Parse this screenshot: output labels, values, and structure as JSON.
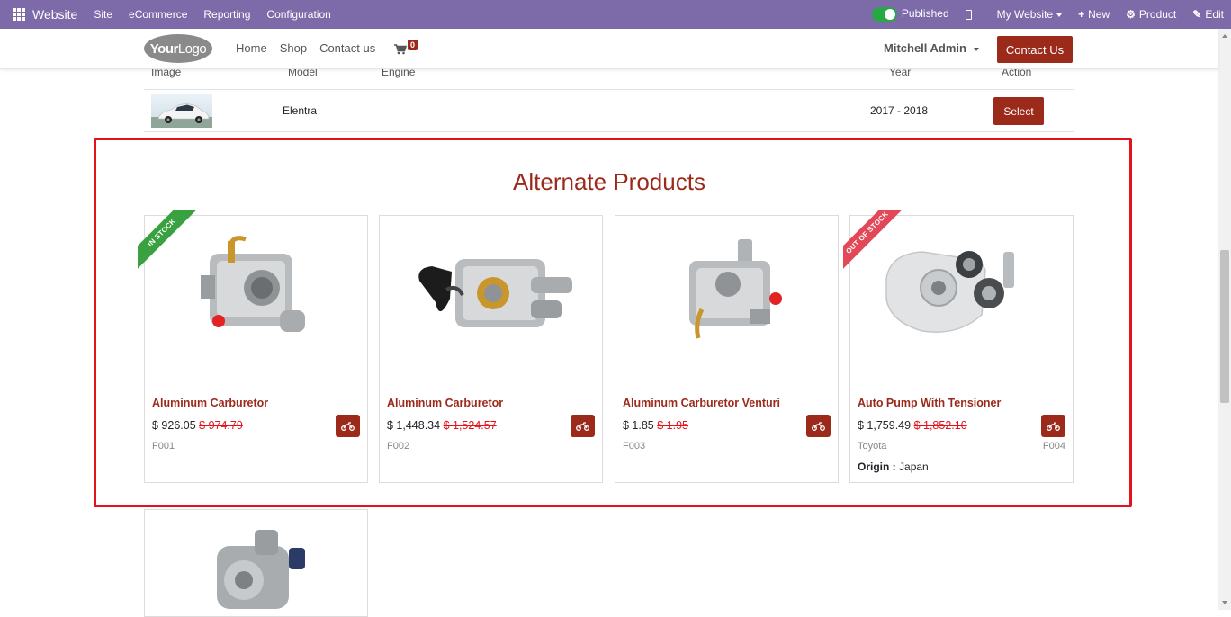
{
  "adminbar": {
    "brand": "Website",
    "menus": [
      "Site",
      "eCommerce",
      "Reporting",
      "Configuration"
    ],
    "published_label": "Published",
    "site_label": "My Website",
    "new_label": "New",
    "product_label": "Product",
    "edit_label": "Edit",
    "color": "#7c6aa9"
  },
  "header": {
    "logo_bold": "Your",
    "logo_light": "Logo",
    "nav": [
      "Home",
      "Shop",
      "Contact us"
    ],
    "cart_count": "0",
    "user": "Mitchell Admin",
    "contact_button": "Contact Us"
  },
  "fitment": {
    "columns": [
      "Image",
      "Model",
      "Engine",
      "Year",
      "Action"
    ],
    "rows": [
      {
        "model": "Elentra",
        "engine": "",
        "year": "2017 - 2018",
        "action": "Select"
      }
    ]
  },
  "alternate": {
    "title": "Alternate Products",
    "products": [
      {
        "name": "Aluminum Carburetor",
        "price": "$ 926.05",
        "old_price": "$ 974.79",
        "ref": "F001",
        "ribbon": "IN STOCK"
      },
      {
        "name": "Aluminum Carburetor",
        "price": "$ 1,448.34",
        "old_price": "$ 1,524.57",
        "ref": "F002"
      },
      {
        "name": "Aluminum Carburetor Venturi",
        "price": "$ 1.85",
        "old_price": "$ 1.95",
        "ref": "F003"
      },
      {
        "name": "Auto Pump With Tensioner",
        "price": "$ 1,759.49",
        "old_price": "$ 1,852.10",
        "brand": "Toyota",
        "ref": "F004",
        "ribbon": "OUT OF STOCK",
        "origin_label": "Origin :",
        "origin_value": "Japan"
      }
    ]
  },
  "colors": {
    "accent": "#9b2a1b",
    "highlight_border": "#e5121b",
    "ribbon_green": "#3aa140",
    "ribbon_red": "#e24857"
  }
}
